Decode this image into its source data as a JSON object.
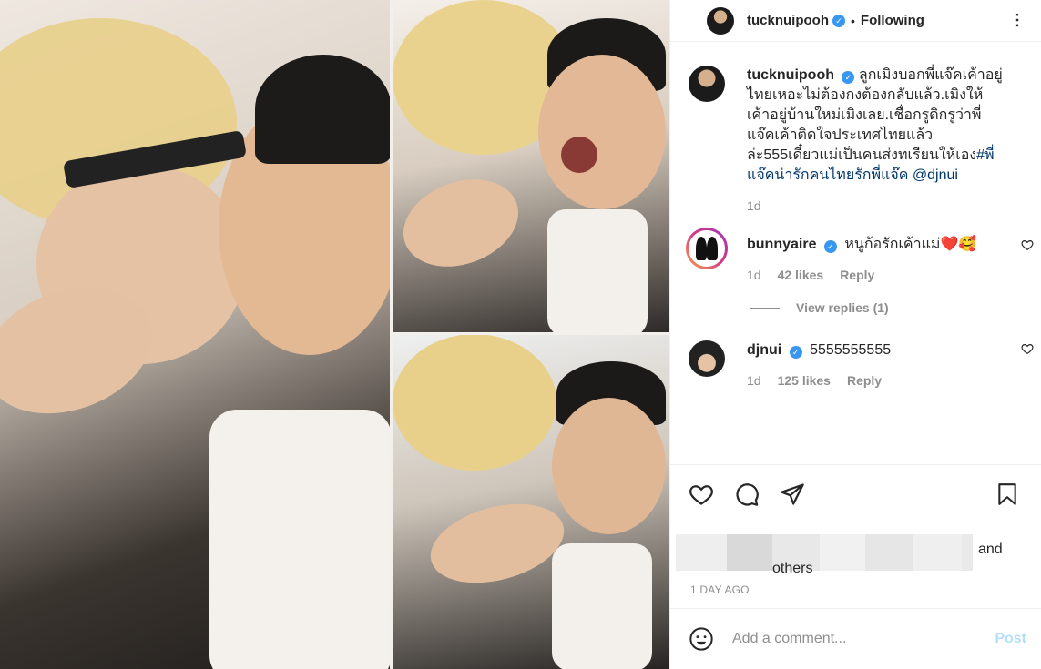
{
  "header": {
    "username": "tucknuipooh",
    "dot": "•",
    "following_label": "Following"
  },
  "caption": {
    "username": "tucknuipooh",
    "text": "ลูกเมิงบอกพี่แจ๊คเค้าอยู่ไทยเหอะไม่ต้องกงต้องกลับแล้ว.เมิงให้เค้าอยู่บ้านใหม่เมิงเลย.เชื่อกรูดิกรูว่าพี่แจ๊คเค้าติดใจประเทศไทยแล้วล่ะ555เดี๋ยวแม่เป็นคนส่งทเรียนให้เอง",
    "hashtags": "#พี่แจ๊คน่ารักคนไทยรักพี่แจ๊ค",
    "mention": "@djnui",
    "time": "1d"
  },
  "comments": [
    {
      "username": "bunnyaire",
      "text": "หนูก้อรักเค้าแม่",
      "emoji": "❤️🥰",
      "time": "1d",
      "likes": "42 likes",
      "reply": "Reply",
      "view_replies": "View replies (1)"
    },
    {
      "username": "djnui",
      "text": "5555555555",
      "time": "1d",
      "likes": "125 likes",
      "reply": "Reply"
    }
  ],
  "likes": {
    "and": "and",
    "others": "others"
  },
  "timestamp": "1 DAY AGO",
  "add_comment": {
    "placeholder": "Add a comment...",
    "post_label": "Post"
  },
  "colors": {
    "verified": "#3897f0",
    "link": "#00376b",
    "muted": "#8e8e8e",
    "post_disabled": "#b2dffc"
  },
  "icons": [
    "more-icon",
    "verified-icon",
    "heart-icon",
    "comment-icon",
    "share-icon",
    "bookmark-icon",
    "emoji-icon"
  ]
}
